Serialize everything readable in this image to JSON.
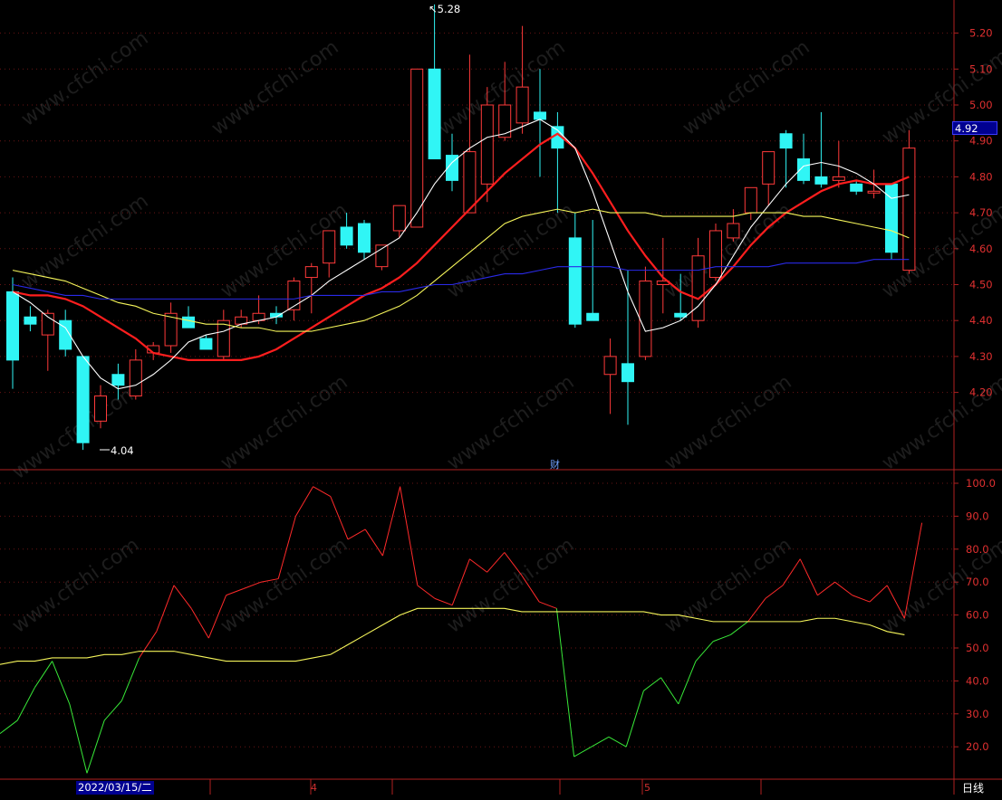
{
  "chart_data": [
    {
      "type": "candlestick",
      "price_axis": {
        "ticks": [
          "5.20",
          "5.10",
          "5.00",
          "4.90",
          "4.80",
          "4.70",
          "4.60",
          "4.50",
          "4.40",
          "4.30",
          "4.20"
        ],
        "ylim": [
          4.0,
          5.3
        ]
      },
      "current_price": "4.92",
      "high_marker": "5.28",
      "low_marker": "4.04",
      "event_marker": "财",
      "candles": [
        {
          "o": 4.48,
          "h": 4.52,
          "l": 4.21,
          "c": 4.29
        },
        {
          "o": 4.41,
          "h": 4.44,
          "l": 4.37,
          "c": 4.39
        },
        {
          "o": 4.36,
          "h": 4.43,
          "l": 4.26,
          "c": 4.42
        },
        {
          "o": 4.4,
          "h": 4.43,
          "l": 4.3,
          "c": 4.32
        },
        {
          "o": 4.3,
          "h": 4.3,
          "l": 4.04,
          "c": 4.06
        },
        {
          "o": 4.12,
          "h": 4.22,
          "l": 4.1,
          "c": 4.19
        },
        {
          "o": 4.25,
          "h": 4.28,
          "l": 4.18,
          "c": 4.22
        },
        {
          "o": 4.19,
          "h": 4.32,
          "l": 4.18,
          "c": 4.29
        },
        {
          "o": 4.31,
          "h": 4.34,
          "l": 4.29,
          "c": 4.33
        },
        {
          "o": 4.33,
          "h": 4.45,
          "l": 4.31,
          "c": 4.42
        },
        {
          "o": 4.41,
          "h": 4.44,
          "l": 4.38,
          "c": 4.38
        },
        {
          "o": 4.35,
          "h": 4.36,
          "l": 4.32,
          "c": 4.32
        },
        {
          "o": 4.3,
          "h": 4.43,
          "l": 4.29,
          "c": 4.4
        },
        {
          "o": 4.39,
          "h": 4.43,
          "l": 4.38,
          "c": 4.41
        },
        {
          "o": 4.4,
          "h": 4.47,
          "l": 4.39,
          "c": 4.42
        },
        {
          "o": 4.42,
          "h": 4.44,
          "l": 4.39,
          "c": 4.41
        },
        {
          "o": 4.43,
          "h": 4.52,
          "l": 4.4,
          "c": 4.51
        },
        {
          "o": 4.52,
          "h": 4.56,
          "l": 4.42,
          "c": 4.55
        },
        {
          "o": 4.56,
          "h": 4.65,
          "l": 4.52,
          "c": 4.65
        },
        {
          "o": 4.66,
          "h": 4.7,
          "l": 4.6,
          "c": 4.61
        },
        {
          "o": 4.67,
          "h": 4.68,
          "l": 4.57,
          "c": 4.59
        },
        {
          "o": 4.55,
          "h": 4.61,
          "l": 4.54,
          "c": 4.61
        },
        {
          "o": 4.65,
          "h": 4.72,
          "l": 4.63,
          "c": 4.72
        },
        {
          "o": 4.66,
          "h": 5.02,
          "l": 4.66,
          "c": 5.1
        },
        {
          "o": 5.1,
          "h": 5.28,
          "l": 4.85,
          "c": 4.85
        },
        {
          "o": 4.86,
          "h": 4.92,
          "l": 4.76,
          "c": 4.79
        },
        {
          "o": 4.7,
          "h": 5.14,
          "l": 4.7,
          "c": 4.87
        },
        {
          "o": 4.78,
          "h": 5.05,
          "l": 4.73,
          "c": 5.0
        },
        {
          "o": 4.91,
          "h": 5.12,
          "l": 4.9,
          "c": 5.0
        },
        {
          "o": 4.95,
          "h": 5.22,
          "l": 4.92,
          "c": 5.05
        },
        {
          "o": 4.98,
          "h": 5.1,
          "l": 4.8,
          "c": 4.96
        },
        {
          "o": 4.94,
          "h": 4.98,
          "l": 4.7,
          "c": 4.88
        },
        {
          "o": 4.63,
          "h": 4.7,
          "l": 4.38,
          "c": 4.39
        },
        {
          "o": 4.42,
          "h": 4.68,
          "l": 4.4,
          "c": 4.4
        },
        {
          "o": 4.25,
          "h": 4.35,
          "l": 4.14,
          "c": 4.3
        },
        {
          "o": 4.28,
          "h": 4.54,
          "l": 4.11,
          "c": 4.23
        },
        {
          "o": 4.3,
          "h": 4.55,
          "l": 4.29,
          "c": 4.51
        },
        {
          "o": 4.5,
          "h": 4.63,
          "l": 4.42,
          "c": 4.51
        },
        {
          "o": 4.42,
          "h": 4.53,
          "l": 4.4,
          "c": 4.41
        },
        {
          "o": 4.4,
          "h": 4.63,
          "l": 4.38,
          "c": 4.58
        },
        {
          "o": 4.52,
          "h": 4.67,
          "l": 4.51,
          "c": 4.65
        },
        {
          "o": 4.63,
          "h": 4.71,
          "l": 4.62,
          "c": 4.67
        },
        {
          "o": 4.7,
          "h": 4.77,
          "l": 4.68,
          "c": 4.77
        },
        {
          "o": 4.78,
          "h": 4.87,
          "l": 4.72,
          "c": 4.87
        },
        {
          "o": 4.92,
          "h": 4.93,
          "l": 4.77,
          "c": 4.88
        },
        {
          "o": 4.85,
          "h": 4.92,
          "l": 4.78,
          "c": 4.79
        },
        {
          "o": 4.8,
          "h": 4.98,
          "l": 4.77,
          "c": 4.78
        },
        {
          "o": 4.79,
          "h": 4.9,
          "l": 4.77,
          "c": 4.8
        },
        {
          "o": 4.78,
          "h": 4.79,
          "l": 4.75,
          "c": 4.76
        },
        {
          "o": 4.76,
          "h": 4.82,
          "l": 4.74,
          "c": 4.76
        },
        {
          "o": 4.78,
          "h": 4.78,
          "l": 4.57,
          "c": 4.59
        },
        {
          "o": 4.54,
          "h": 4.93,
          "l": 4.53,
          "c": 4.88
        }
      ],
      "series": [
        {
          "color": "#ff1e1e",
          "values": [
            4.48,
            4.47,
            4.47,
            4.46,
            4.44,
            4.41,
            4.38,
            4.35,
            4.31,
            4.3,
            4.29,
            4.29,
            4.29,
            4.29,
            4.3,
            4.32,
            4.35,
            4.38,
            4.41,
            4.44,
            4.47,
            4.49,
            4.52,
            4.56,
            4.61,
            4.66,
            4.71,
            4.76,
            4.81,
            4.85,
            4.89,
            4.92,
            4.88,
            4.81,
            4.73,
            4.65,
            4.58,
            4.52,
            4.48,
            4.46,
            4.5,
            4.55,
            4.61,
            4.66,
            4.7,
            4.73,
            4.76,
            4.78,
            4.79,
            4.78,
            4.78,
            4.8
          ]
        },
        {
          "color": "#ffffff",
          "values": [
            4.48,
            4.45,
            4.41,
            4.38,
            4.3,
            4.24,
            4.21,
            4.22,
            4.25,
            4.29,
            4.34,
            4.36,
            4.37,
            4.39,
            4.4,
            4.41,
            4.44,
            4.47,
            4.51,
            4.54,
            4.57,
            4.6,
            4.63,
            4.7,
            4.78,
            4.84,
            4.88,
            4.91,
            4.92,
            4.94,
            4.96,
            4.93,
            4.88,
            4.76,
            4.62,
            4.48,
            4.37,
            4.38,
            4.4,
            4.44,
            4.5,
            4.58,
            4.66,
            4.72,
            4.78,
            4.83,
            4.84,
            4.83,
            4.81,
            4.78,
            4.74,
            4.75
          ]
        },
        {
          "color": "#f5f55a",
          "values": [
            4.54,
            4.53,
            4.52,
            4.51,
            4.49,
            4.47,
            4.45,
            4.44,
            4.42,
            4.41,
            4.4,
            4.39,
            4.39,
            4.38,
            4.38,
            4.37,
            4.37,
            4.37,
            4.38,
            4.39,
            4.4,
            4.42,
            4.44,
            4.47,
            4.51,
            4.55,
            4.59,
            4.63,
            4.67,
            4.69,
            4.7,
            4.71,
            4.7,
            4.71,
            4.7,
            4.7,
            4.7,
            4.69,
            4.69,
            4.69,
            4.69,
            4.69,
            4.7,
            4.7,
            4.7,
            4.69,
            4.69,
            4.68,
            4.67,
            4.66,
            4.65,
            4.63
          ]
        },
        {
          "color": "#2a2ae8",
          "values": [
            4.5,
            4.49,
            4.48,
            4.47,
            4.47,
            4.46,
            4.46,
            4.46,
            4.46,
            4.46,
            4.46,
            4.46,
            4.46,
            4.46,
            4.46,
            4.46,
            4.46,
            4.47,
            4.47,
            4.47,
            4.47,
            4.48,
            4.48,
            4.49,
            4.5,
            4.5,
            4.51,
            4.52,
            4.53,
            4.53,
            4.54,
            4.55,
            4.55,
            4.55,
            4.55,
            4.54,
            4.54,
            4.54,
            4.54,
            4.54,
            4.55,
            4.55,
            4.55,
            4.55,
            4.56,
            4.56,
            4.56,
            4.56,
            4.56,
            4.57,
            4.57,
            4.57
          ]
        }
      ]
    },
    {
      "type": "line",
      "y_axis": {
        "ticks": [
          "100.0",
          "90.0",
          "80.0",
          "70.0",
          "60.0",
          "50.0",
          "40.0",
          "30.0",
          "20.0"
        ],
        "ylim": [
          10,
          103
        ]
      },
      "series": [
        {
          "values": [
            24,
            28,
            38,
            46,
            33,
            12,
            28,
            34,
            47,
            55,
            69,
            62,
            53,
            66,
            68,
            70,
            71,
            90,
            99,
            96,
            83,
            86,
            78,
            99,
            69,
            65,
            63,
            77,
            73,
            79,
            72,
            64,
            62,
            17,
            20,
            23,
            20,
            37,
            41,
            33,
            46,
            52,
            54,
            58,
            65,
            69,
            77,
            66,
            70,
            66,
            64,
            69,
            59,
            88
          ]
        },
        {
          "values": [
            45,
            46,
            46,
            47,
            47,
            47,
            48,
            48,
            49,
            49,
            49,
            48,
            47,
            46,
            46,
            46,
            46,
            46,
            47,
            48,
            51,
            54,
            57,
            60,
            62,
            62,
            62,
            62,
            62,
            62,
            61,
            61,
            61,
            61,
            61,
            61,
            61,
            61,
            60,
            60,
            59,
            58,
            58,
            58,
            58,
            58,
            58,
            59,
            59,
            58,
            57,
            55,
            54
          ]
        }
      ]
    }
  ],
  "x_axis": {
    "selected_date": "2022/03/15/二",
    "months": [
      "4",
      "5"
    ]
  },
  "period_button": "日线",
  "watermark": "www.cfchi.com"
}
